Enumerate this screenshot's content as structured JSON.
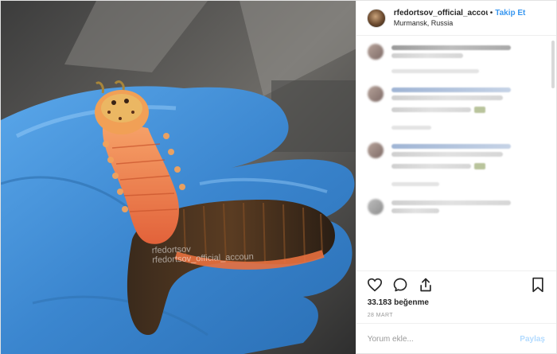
{
  "post": {
    "username": "rfedortsov_official_accou",
    "separator": "•",
    "follow_label": "Takip Et",
    "location": "Murmansk, Russia",
    "likes": "33.183 beğenme",
    "date": "28 MART",
    "comment_placeholder": "Yorum ekle...",
    "post_label": "Paylaş",
    "watermark": {
      "line1": "rfedortsov",
      "line2": "rfedortsov_official_accoun"
    }
  },
  "icons": {
    "like": "heart-icon",
    "comment": "comment-icon",
    "share": "share-icon",
    "save": "bookmark-icon"
  },
  "colors": {
    "follow": "#3897f0",
    "post_disabled": "#b3dbff",
    "text": "#262626",
    "muted": "#999999",
    "glove": "#3f8fd6"
  }
}
